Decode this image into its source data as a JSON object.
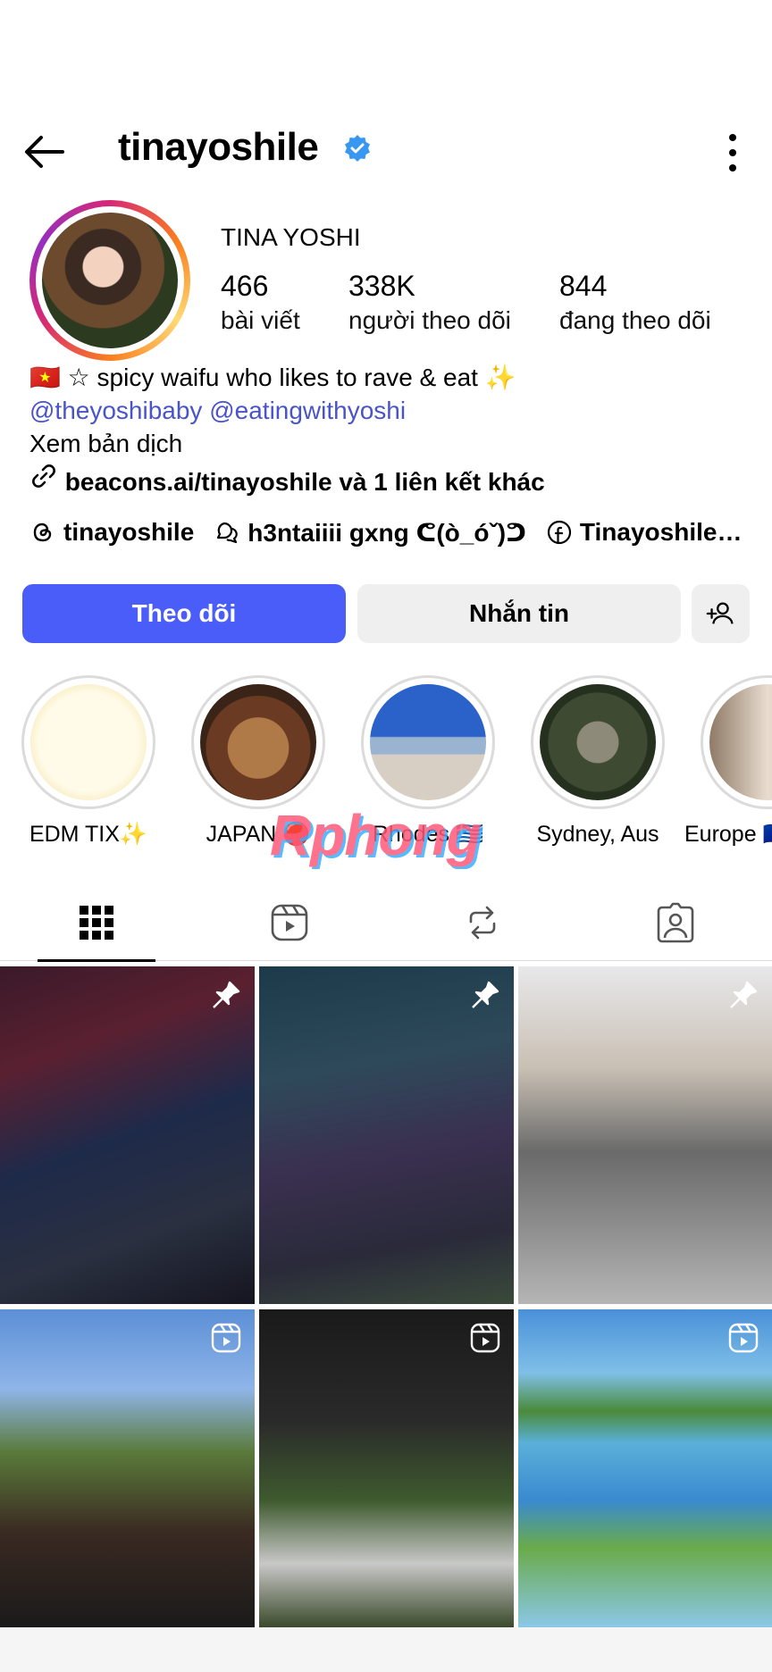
{
  "header": {
    "username": "tinayoshile"
  },
  "profile": {
    "display_name": "TINA YOSHI",
    "stats": [
      {
        "value": "466",
        "label": "bài viết"
      },
      {
        "value": "338K",
        "label": "người theo dõi"
      },
      {
        "value": "844",
        "label": "đang theo dõi"
      }
    ],
    "bio_line1": "🇻🇳 ☆ spicy waifu who likes to rave & eat ✨",
    "mention1": "@theyoshibaby",
    "mention2": "@eatingwithyoshi",
    "translate": "Xem bản dịch",
    "link": "beacons.ai/tinayoshile và 1 liên kết khác"
  },
  "socials": [
    {
      "icon": "threads-icon",
      "label": "tinayoshile"
    },
    {
      "icon": "chat-icon",
      "label": "h3ntaiiii gxng ᕦ(ò_óˇ)ᕤ"
    },
    {
      "icon": "facebook-icon",
      "label": "Tinayoshile…"
    }
  ],
  "actions": {
    "follow": "Theo dõi",
    "message": "Nhắn tin"
  },
  "highlights": [
    {
      "label": "EDM TIX✨"
    },
    {
      "label": "JAPAN 🔴"
    },
    {
      "label": "Rhodes 🇬🇷"
    },
    {
      "label": "Sydney, Aus"
    },
    {
      "label": "Europe 🇫🇷"
    }
  ],
  "watermark": "Rphong",
  "colors": {
    "follow_button": "#4a5df9",
    "mention": "#4a54c9",
    "verified": "#3897f0"
  },
  "grid_badges": [
    "pin-icon",
    "pin-icon",
    "pin-icon",
    "reel-icon",
    "reel-icon",
    "reel-icon"
  ]
}
